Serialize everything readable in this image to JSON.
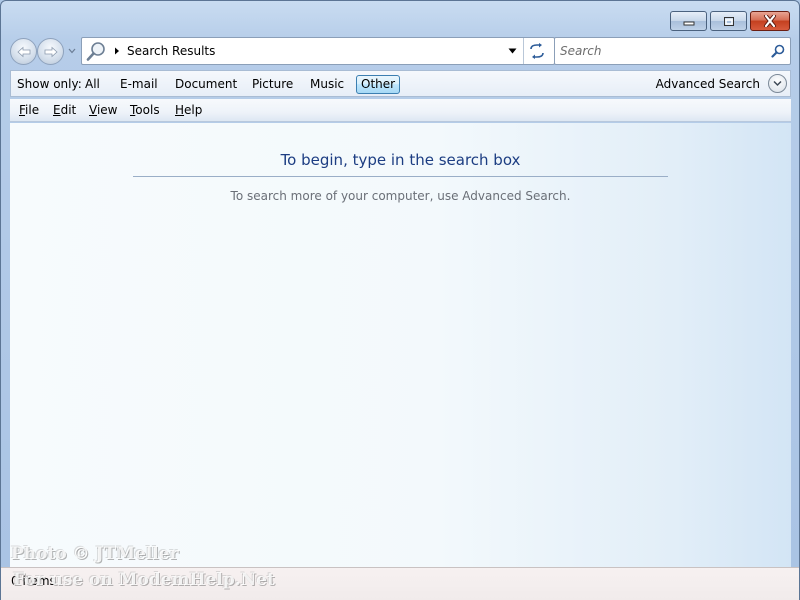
{
  "window": {
    "caption_buttons": [
      "minimize-icon",
      "maximize-icon",
      "close-icon"
    ]
  },
  "nav": {
    "back_icon": "back-arrow-icon",
    "forward_icon": "forward-arrow-icon"
  },
  "address": {
    "icon": "search-magnifier-icon",
    "location": "Search Results"
  },
  "search": {
    "placeholder": "Search"
  },
  "filter": {
    "label": "Show only:",
    "items": [
      "All",
      "E-mail",
      "Document",
      "Picture",
      "Music",
      "Other"
    ],
    "active": "Other",
    "advanced_label": "Advanced Search"
  },
  "menu": {
    "items": [
      {
        "accel": "F",
        "rest": "ile"
      },
      {
        "accel": "E",
        "rest": "dit"
      },
      {
        "accel": "V",
        "rest": "iew"
      },
      {
        "accel": "T",
        "rest": "ools"
      },
      {
        "accel": "H",
        "rest": "elp"
      }
    ]
  },
  "content": {
    "title": "To begin, type in the search box",
    "subtitle": "To search more of your computer, use Advanced Search."
  },
  "status": {
    "text": "0 items"
  },
  "watermark": {
    "line1": "Photo © JTMeller",
    "line2": "For use on ModemHelp.Net"
  },
  "colors": {
    "frame": "#b6cde9",
    "title_text": "#1c3d82",
    "close_button": "#c4401f",
    "active_filter": "#bee6fd"
  }
}
